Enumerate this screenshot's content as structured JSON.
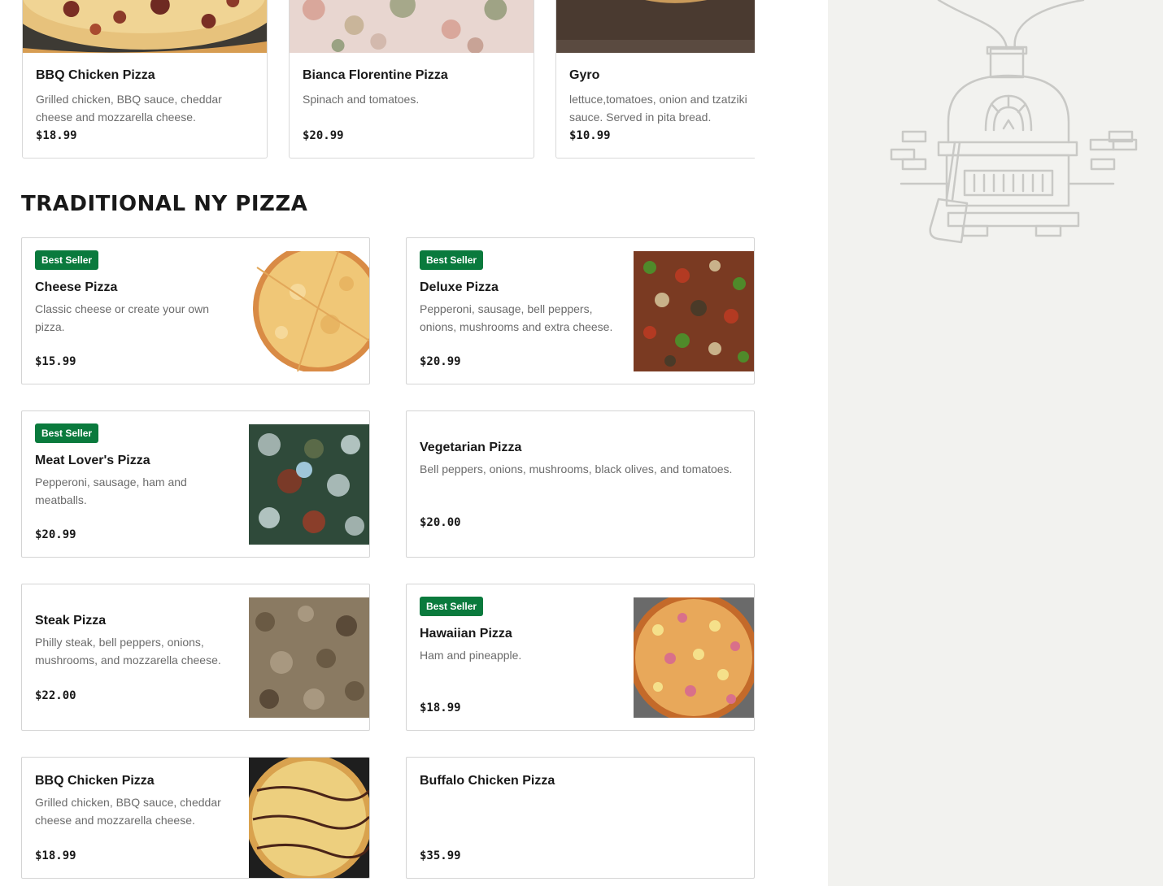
{
  "featured": [
    {
      "title": "BBQ Chicken Pizza",
      "description": "Grilled chicken, BBQ sauce, cheddar cheese and mozzarella cheese.",
      "price": "$18.99"
    },
    {
      "title": "Bianca Florentine Pizza",
      "description": "Spinach and tomatoes.",
      "price": "$20.99"
    },
    {
      "title": "Gyro",
      "description": "lettuce,tomatoes, onion and tzatziki sauce. Served in pita bread.",
      "price": "$10.99"
    }
  ],
  "section": {
    "title": "TRADITIONAL NY PIZZA"
  },
  "items": [
    {
      "badge": "Best Seller",
      "title": "Cheese Pizza",
      "description": "Classic cheese or create your own pizza.",
      "price": "$15.99"
    },
    {
      "badge": "Best Seller",
      "title": "Deluxe Pizza",
      "description": "Pepperoni, sausage, bell peppers, onions, mushrooms and extra cheese.",
      "price": "$20.99"
    },
    {
      "badge": "Best Seller",
      "title": "Meat Lover's Pizza",
      "description": "Pepperoni, sausage, ham and meatballs.",
      "price": "$20.99"
    },
    {
      "title": "Vegetarian Pizza",
      "description": "Bell peppers, onions, mushrooms, black olives, and tomatoes.",
      "price": "$20.00"
    },
    {
      "title": "Steak Pizza",
      "description": "Philly steak, bell peppers, onions, mushrooms, and mozzarella cheese.",
      "price": "$22.00"
    },
    {
      "badge": "Best Seller",
      "title": "Hawaiian Pizza",
      "description": "Ham and pineapple.",
      "price": "$18.99"
    },
    {
      "title": "BBQ Chicken Pizza",
      "description": "Grilled chicken, BBQ sauce, cheddar cheese and mozzarella cheese.",
      "price": "$18.99"
    },
    {
      "title": "Buffalo Chicken Pizza",
      "description": "",
      "price": "$35.99"
    }
  ],
  "colors": {
    "badge_bg": "#0a7a3d",
    "sidebar_bg": "#f2f2ef"
  },
  "icons": [
    "pizza-oven-illustration"
  ]
}
